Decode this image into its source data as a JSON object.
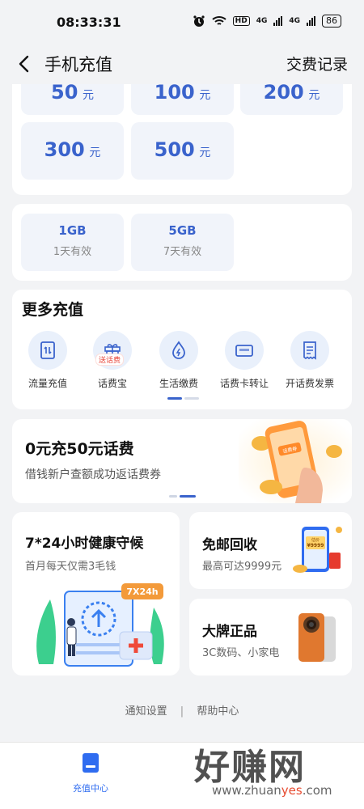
{
  "status": {
    "time": "08:33:31",
    "battery": "86",
    "net1": "4G",
    "net2": "4G",
    "hd": "HD"
  },
  "header": {
    "title": "手机充值",
    "records": "交费记录"
  },
  "amounts": [
    {
      "num": "50",
      "unit": "元"
    },
    {
      "num": "100",
      "unit": "元"
    },
    {
      "num": "200",
      "unit": "元"
    },
    {
      "num": "300",
      "unit": "元"
    },
    {
      "num": "500",
      "unit": "元"
    }
  ],
  "data_packs": [
    {
      "size": "1GB",
      "validity": "1天有效"
    },
    {
      "size": "5GB",
      "validity": "7天有效"
    }
  ],
  "more": {
    "title": "更多充值",
    "items": [
      {
        "label": "流量充值",
        "icon": "data-recharge-icon"
      },
      {
        "label": "话费宝",
        "icon": "gift-icon",
        "tag": "送话费"
      },
      {
        "label": "生活缴费",
        "icon": "water-drop-icon"
      },
      {
        "label": "话费卡转让",
        "icon": "card-icon"
      },
      {
        "label": "开话费发票",
        "icon": "receipt-icon"
      }
    ]
  },
  "promo": {
    "title": "0元充50元话费",
    "subtitle": "借钱新户查额成功返话费券",
    "phone_badge": "话费券"
  },
  "health": {
    "title": "7*24小时健康守候",
    "subtitle": "首月每天仅需3毛钱",
    "badge": "7X24h"
  },
  "recycle": {
    "title": "免邮回收",
    "subtitle": "最高可达9999元",
    "badge_top": "估价",
    "badge_price": "¥9999"
  },
  "brand": {
    "title": "大牌正品",
    "subtitle": "3C数码、小家电"
  },
  "footer": {
    "settings": "通知设置",
    "separator": "|",
    "help": "帮助中心"
  },
  "tabbar": {
    "recharge_center": "充值中心"
  },
  "watermark": {
    "text": "好赚网",
    "url_prefix": "www.zhuan",
    "url_mid": "yes",
    "url_suffix": ".com"
  },
  "colors": {
    "accent": "#3a63cc",
    "tab_active": "#2f6cf0",
    "tile_bg": "#f1f4fa"
  }
}
